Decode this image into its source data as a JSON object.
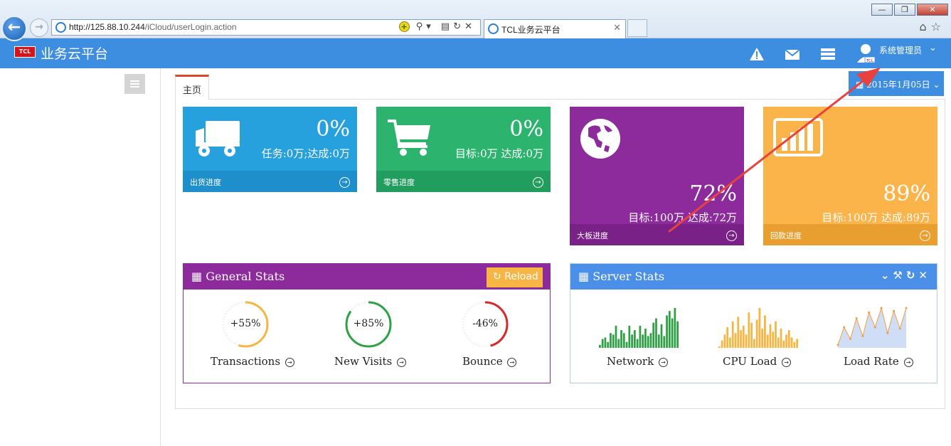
{
  "browser": {
    "url_host": "http://125.88.10.244",
    "url_path": "/iCloud/userLogin.action",
    "tab_title": "TCL业务云平台",
    "tab_close": "✕"
  },
  "header": {
    "logo": "TCL",
    "title": "业务云平台",
    "user_name": "系统管理员",
    "alert_icon": "warning-icon",
    "mail_icon": "envelope-icon",
    "tasks_icon": "server-icon"
  },
  "tabs": {
    "home": "主页"
  },
  "date_button": "2015年1月05日",
  "tiles": [
    {
      "percent": "0%",
      "detail": "任务:0万;达成:0万",
      "footer": "出货进度",
      "color": "#27a1de",
      "foot_color": "#1f8fcb",
      "icon": "truck-icon",
      "progress": 0
    },
    {
      "percent": "0%",
      "detail": "目标:0万 达成:0万",
      "footer": "零售进度",
      "color": "#2cb46e",
      "foot_color": "#219e5e",
      "icon": "cart-icon",
      "progress": 0
    },
    {
      "percent": "72%",
      "detail": "目标:100万 达成:72万",
      "footer": "大板进度",
      "color": "#8d2b9c",
      "foot_color": "#7a2188",
      "icon": "globe-icon",
      "progress": 72
    },
    {
      "percent": "89%",
      "detail": "目标:100万 达成:89万",
      "footer": "回款进度",
      "color": "#fbb44a",
      "foot_color": "#e99f30",
      "icon": "bar-chart-icon",
      "progress": 89
    }
  ],
  "general_stats": {
    "title": "General Stats",
    "reload": "Reload",
    "header_color": "#8d2b9c",
    "gauges": [
      {
        "value": "+55%",
        "label": "Transactions",
        "color": "#f7b543",
        "fraction": 0.55
      },
      {
        "value": "+85%",
        "label": "New Visits",
        "color": "#2fa145",
        "fraction": 0.85
      },
      {
        "value": "-46%",
        "label": "Bounce",
        "color": "#d42a2a",
        "fraction": 0.46
      }
    ]
  },
  "server_stats": {
    "title": "Server Stats",
    "header_color": "#4a8fe8",
    "charts": [
      {
        "label": "Network",
        "type": "bar",
        "color": "#2fa145",
        "values": [
          2,
          6,
          7,
          4,
          10,
          9,
          15,
          6,
          12,
          10,
          4,
          15,
          9,
          12,
          6,
          15,
          9,
          13,
          8,
          10,
          17,
          20,
          9,
          16,
          8,
          22,
          25,
          20,
          27,
          18
        ]
      },
      {
        "label": "CPU Load",
        "type": "bar",
        "color": "#f7b543",
        "values": [
          1,
          5,
          9,
          14,
          7,
          18,
          10,
          21,
          12,
          15,
          9,
          24,
          17,
          6,
          19,
          27,
          13,
          22,
          9,
          16,
          11,
          18,
          7,
          13,
          5,
          9,
          12,
          7,
          4,
          6
        ]
      },
      {
        "label": "Load Rate",
        "type": "area",
        "color": "#cfddf6",
        "line_color": "#f0a040",
        "values": [
          2,
          14,
          6,
          20,
          8,
          24,
          14,
          27,
          10,
          25,
          13,
          27
        ]
      }
    ]
  }
}
